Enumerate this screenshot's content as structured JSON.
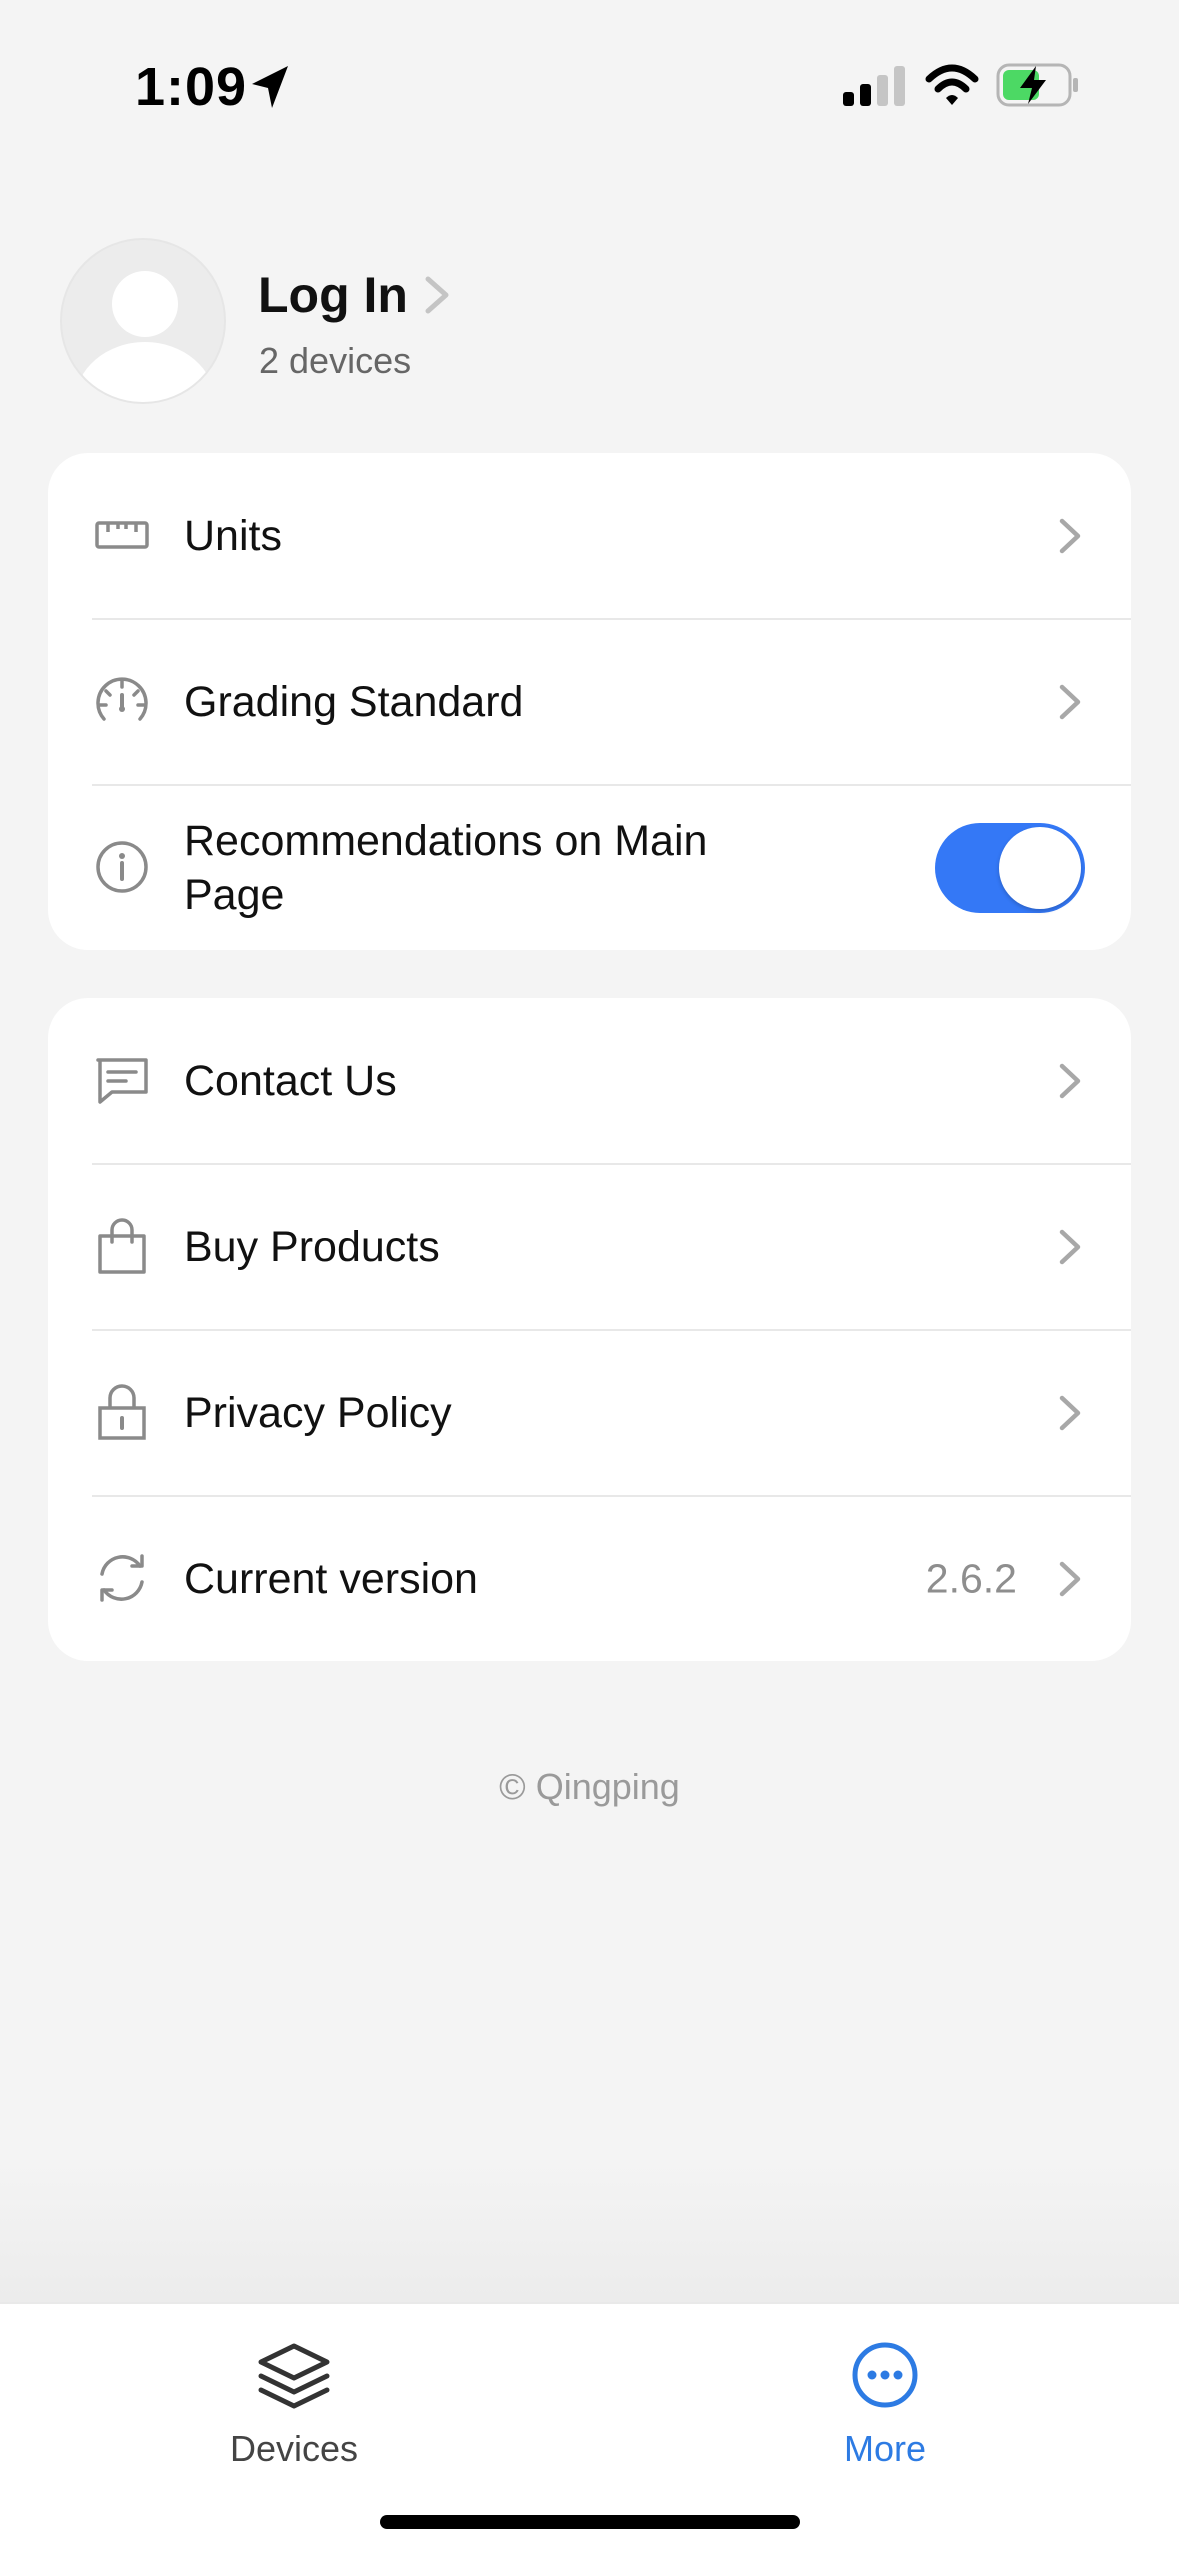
{
  "status_bar": {
    "time": "1:09"
  },
  "profile": {
    "title": "Log In",
    "subtitle": "2 devices"
  },
  "settings_group": [
    {
      "label": "Units",
      "icon": "ruler-icon"
    },
    {
      "label": "Grading Standard",
      "icon": "gauge-icon"
    },
    {
      "label": "Recommendations on Main Page",
      "icon": "info-icon",
      "toggle_on": true
    }
  ],
  "info_group": [
    {
      "label": "Contact Us",
      "icon": "chat-icon"
    },
    {
      "label": "Buy Products",
      "icon": "shopping-bag-icon"
    },
    {
      "label": "Privacy Policy",
      "icon": "lock-icon"
    },
    {
      "label": "Current version",
      "icon": "refresh-icon",
      "value": "2.6.2"
    }
  ],
  "footer": {
    "copyright": "© Qingping"
  },
  "tab_bar": {
    "tabs": [
      {
        "label": "Devices",
        "icon": "layers-icon",
        "active": false
      },
      {
        "label": "More",
        "icon": "more-icon",
        "active": true
      }
    ]
  },
  "colors": {
    "accent": "#3478f6",
    "tab_active": "#2d7be3",
    "background": "#f4f4f4"
  }
}
